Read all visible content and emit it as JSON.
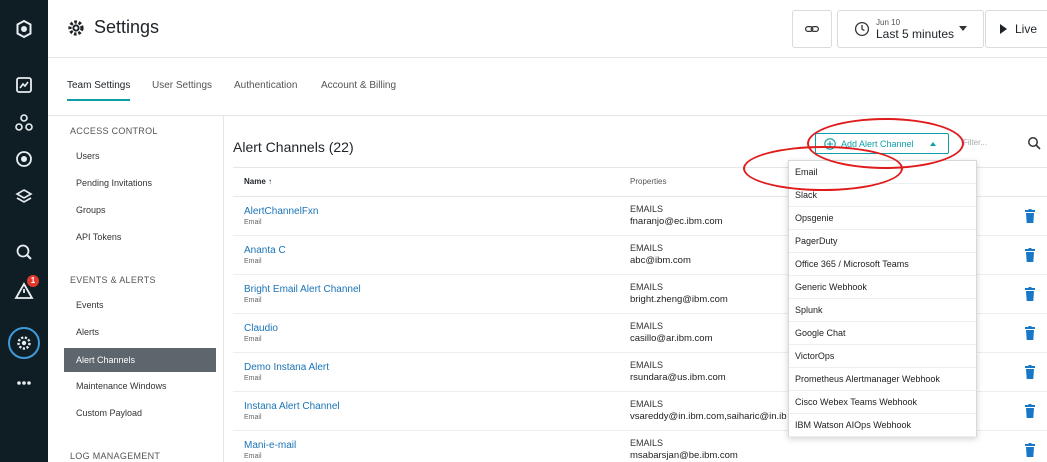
{
  "header": {
    "title": "Settings",
    "time_date": "Jun 10",
    "time_range": "Last 5 minutes",
    "live_label": "Live"
  },
  "rail": {
    "alert_badge": "1",
    "icons": [
      "logo-icon",
      "dashboard-icon",
      "applications-icon",
      "infrastructure-icon",
      "platforms-icon",
      "analyze-icon",
      "events-icon",
      "settings-icon",
      "more-icon"
    ]
  },
  "tabs": [
    {
      "label": "Team Settings",
      "active": true
    },
    {
      "label": "User Settings",
      "active": false
    },
    {
      "label": "Authentication",
      "active": false
    },
    {
      "label": "Account & Billing",
      "active": false
    }
  ],
  "sidenav": {
    "access_control_heading": "ACCESS CONTROL",
    "access_items": [
      "Users",
      "Pending Invitations",
      "Groups",
      "API Tokens"
    ],
    "events_heading": "EVENTS & ALERTS",
    "events_items": [
      "Events",
      "Alerts",
      "Alert Channels",
      "Maintenance Windows",
      "Custom Payload"
    ],
    "log_heading": "LOG MANAGEMENT"
  },
  "main": {
    "title": "Alert Channels (22)",
    "add_button_label": "Add Alert Channel",
    "filter_placeholder": "Filter...",
    "columns": {
      "name": "Name",
      "properties": "Properties"
    },
    "rows": [
      {
        "name": "AlertChannelFxn",
        "type": "Email",
        "prop_type": "EMAILS",
        "prop_value": "fnaranjo@ec.ibm.com"
      },
      {
        "name": "Ananta C",
        "type": "Email",
        "prop_type": "EMAILS",
        "prop_value": "abc@ibm.com"
      },
      {
        "name": "Bright Email Alert Channel",
        "type": "Email",
        "prop_type": "EMAILS",
        "prop_value": "bright.zheng@ibm.com"
      },
      {
        "name": "Claudio",
        "type": "Email",
        "prop_type": "EMAILS",
        "prop_value": "casillo@ar.ibm.com"
      },
      {
        "name": "Demo Instana Alert",
        "type": "Email",
        "prop_type": "EMAILS",
        "prop_value": "rsundara@us.ibm.com"
      },
      {
        "name": "Instana Alert Channel",
        "type": "Email",
        "prop_type": "EMAILS",
        "prop_value": "vsareddy@in.ibm.com,saiharic@in.ib"
      },
      {
        "name": "Mani-e-mail",
        "type": "Email",
        "prop_type": "EMAILS",
        "prop_value": "msabarsjan@be.ibm.com"
      }
    ]
  },
  "dropdown": {
    "options": [
      "Email",
      "Slack",
      "Opsgenie",
      "PagerDuty",
      "Office 365 / Microsoft Teams",
      "Generic Webhook",
      "Splunk",
      "Google Chat",
      "VictorOps",
      "Prometheus Alertmanager Webhook",
      "Cisco Webex Teams Webhook",
      "IBM Watson AIOps Webhook"
    ]
  },
  "colors": {
    "rail_bg": "#0f1d24",
    "accent_teal": "#0f9ea8",
    "link_blue": "#1b74b8",
    "trash_blue": "#1877c7",
    "annotation_red": "#e01b1b",
    "active_nav_bg": "#5d666d"
  }
}
